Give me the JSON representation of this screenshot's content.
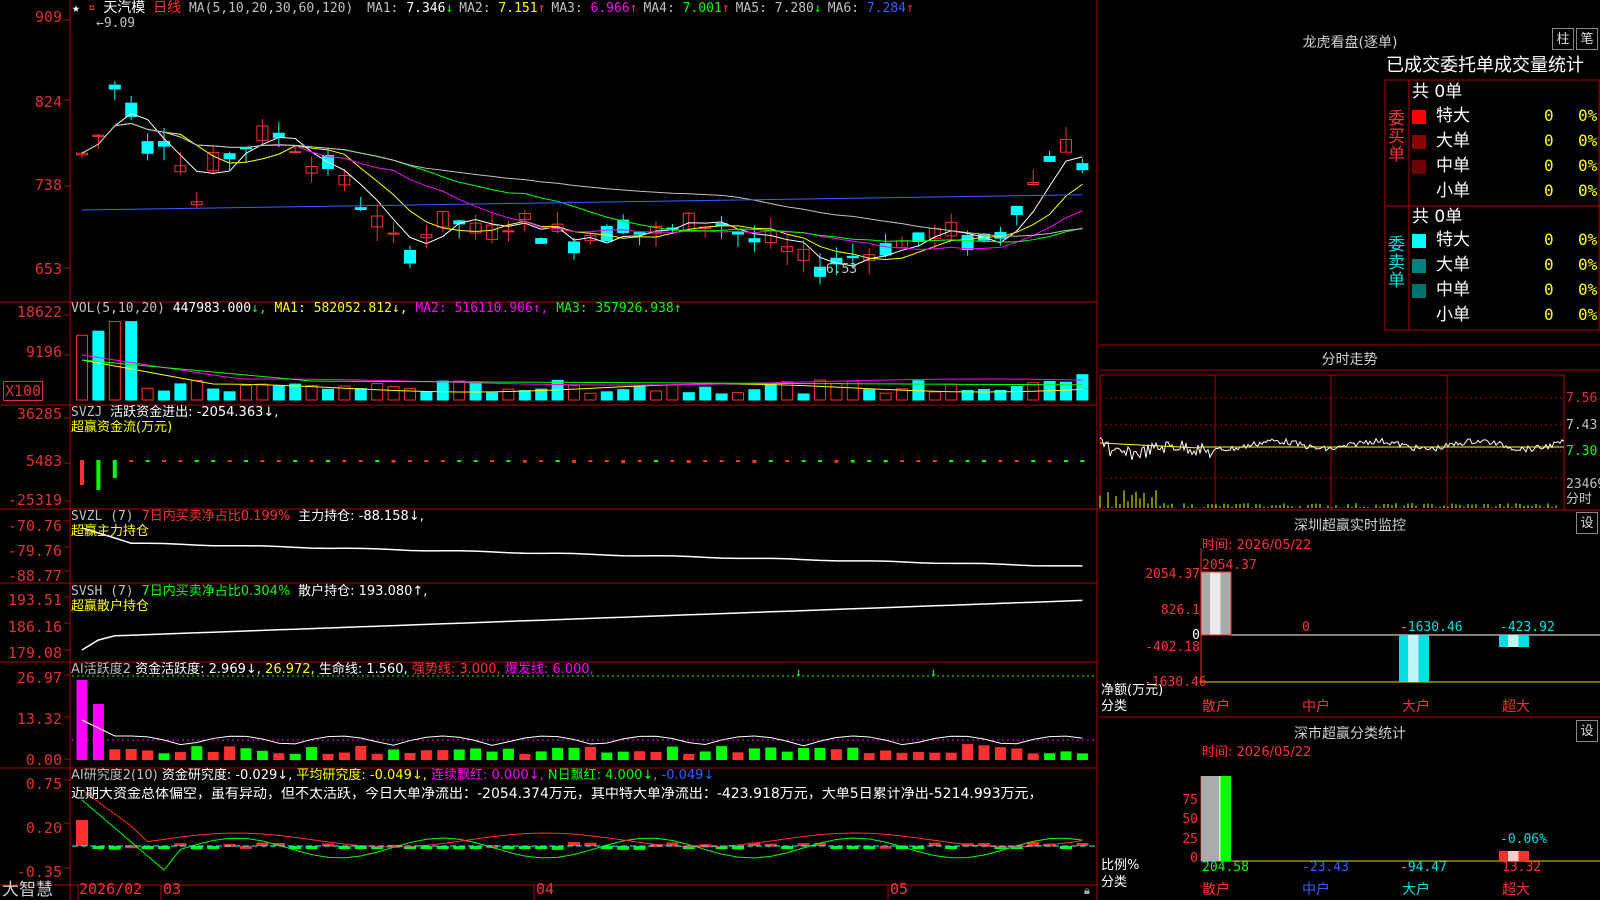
{
  "header": {
    "stock_name": "天汽模",
    "period": "日线",
    "ma_label": "MA(5,10,20,30,60,120)",
    "ma_values": [
      {
        "label": "MA1:",
        "value": "7.346",
        "arrow": "↓",
        "color": "#ffffff"
      },
      {
        "label": "MA2:",
        "value": "7.151",
        "arrow": "↑",
        "color": "#ffff00"
      },
      {
        "label": "MA3:",
        "value": "6.966",
        "arrow": "↑",
        "color": "#ff00ff"
      },
      {
        "label": "MA4:",
        "value": "7.001",
        "arrow": "↑",
        "color": "#00ff00"
      },
      {
        "label": "MA5:",
        "value": "7.280",
        "arrow": "↓",
        "color": "#c0c0c0"
      },
      {
        "label": "MA6:",
        "value": "7.284",
        "arrow": "↑",
        "color": "#3060ff"
      }
    ],
    "high_mark": "9.09",
    "low_mark": "6.53"
  },
  "price_axis": [
    "909",
    "824",
    "738",
    "653"
  ],
  "vol": {
    "title": "VOL(5,10,20)",
    "value": "447983.000",
    "ma1": "MA1: 582052.812↓,",
    "ma2": "MA2: 516110.906↑,",
    "ma3": "MA3: 357926.938↑",
    "axis": [
      "18622",
      "9196",
      "X100"
    ]
  },
  "svzj": {
    "title": "SVZJ",
    "label": "活跃资金进出: -2054.363↓,",
    "sub": "超赢资金流(万元)",
    "axis": [
      "36285",
      "5483",
      "-25319"
    ]
  },
  "svzl": {
    "title": "SVZL (7)",
    "ratio": "7日内买卖净占比0.199%",
    "label": "主力持仓: -88.158↓,",
    "sub": "超赢主力持仓",
    "axis": [
      "-70.76",
      "-79.76",
      "-88.77"
    ]
  },
  "svsh": {
    "title": "SVSH (7)",
    "ratio": "7日内买卖净占比0.304%",
    "label": "散户持仓: 193.080↑,",
    "sub": "超赢散户持仓",
    "axis": [
      "193.51",
      "186.16",
      "179.08"
    ]
  },
  "ai1": {
    "title": "AI活跃度2",
    "label1": "资金活跃度: 2.969↓,",
    "label2": "26.972,",
    "label3": "生命线: 1.560,",
    "label4": "强势线: 3.000,",
    "label5": "爆发线: 6.000,",
    "axis": [
      "26.97",
      "13.32",
      "0.00"
    ]
  },
  "ai2": {
    "title": "AI研究度2(10)",
    "label1": "资金研究度: -0.029↓,",
    "label2": "平均研究度: -0.049↓,",
    "label3": "连续飘红: 0.000↓,",
    "label4": "N日飘红: 4.000↓,",
    "label5": "-0.049↓",
    "comment": "近期大资金总体偏空，虽有异动，但不太活跃，今日大单净流出：-2054.374万元，其中特大单净流出：-423.918万元，大单5日累计净出-5214.993万元，",
    "axis": [
      "0.75",
      "0.20",
      "-0.35"
    ]
  },
  "bottom_bar": {
    "brand": "大智慧",
    "dates": [
      "2026/02",
      "03",
      "04",
      "05"
    ]
  },
  "longhu": {
    "title": "龙虎看盘(逐单)",
    "btn1": "柱",
    "btn2": "笔",
    "tabs": "已成交委托单成交量统计",
    "buy_label": "委买单",
    "sell_label": "委卖单",
    "buy_total": "共 0单",
    "sell_total": "共 0单",
    "buy_rows": [
      {
        "name": "特大",
        "count": "0",
        "pct": "0%",
        "color": "#ff0000"
      },
      {
        "name": "大单",
        "count": "0",
        "pct": "0%",
        "color": "#8b0000"
      },
      {
        "name": "中单",
        "count": "0",
        "pct": "0%",
        "color": "#700000"
      },
      {
        "name": "小单",
        "count": "0",
        "pct": "0%",
        "color": "#000000"
      }
    ],
    "sell_rows": [
      {
        "name": "特大",
        "count": "0",
        "pct": "0%",
        "color": "#00ffff"
      },
      {
        "name": "大单",
        "count": "0",
        "pct": "0%",
        "color": "#008080"
      },
      {
        "name": "中单",
        "count": "0",
        "pct": "0%",
        "color": "#007070"
      },
      {
        "name": "小单",
        "count": "0",
        "pct": "0%",
        "color": "#000000"
      }
    ]
  },
  "fenshi": {
    "title": "分时走势",
    "axis": [
      "7.56",
      "7.43",
      "7.30"
    ],
    "vol_label": "23469",
    "footer": "分时"
  },
  "monitor": {
    "title": "深圳超赢实时监控",
    "btn": "设",
    "time": "时间: 2026/05/22",
    "axis": [
      "2054.37",
      "826.1",
      "0",
      "-402.18",
      "-1630.46"
    ],
    "values": [
      "2054.37",
      "0",
      "-1630.46",
      "-423.92"
    ],
    "ylabel": "净额(万元)",
    "xlabel": "分类",
    "categories": [
      "散户",
      "中户",
      "大户",
      "超大"
    ]
  },
  "classify": {
    "title": "深市超赢分类统计",
    "btn": "设",
    "time": "时间: 2026/05/22",
    "axis": [
      "75",
      "50",
      "25",
      "0"
    ],
    "pct_label": "-0.06%",
    "values": [
      "204.58",
      "-23.43",
      "-94.47",
      "13.32"
    ],
    "ylabel": "比例%",
    "xlabel": "分类",
    "categories": [
      "散户",
      "中户",
      "大户",
      "超大"
    ]
  }
}
